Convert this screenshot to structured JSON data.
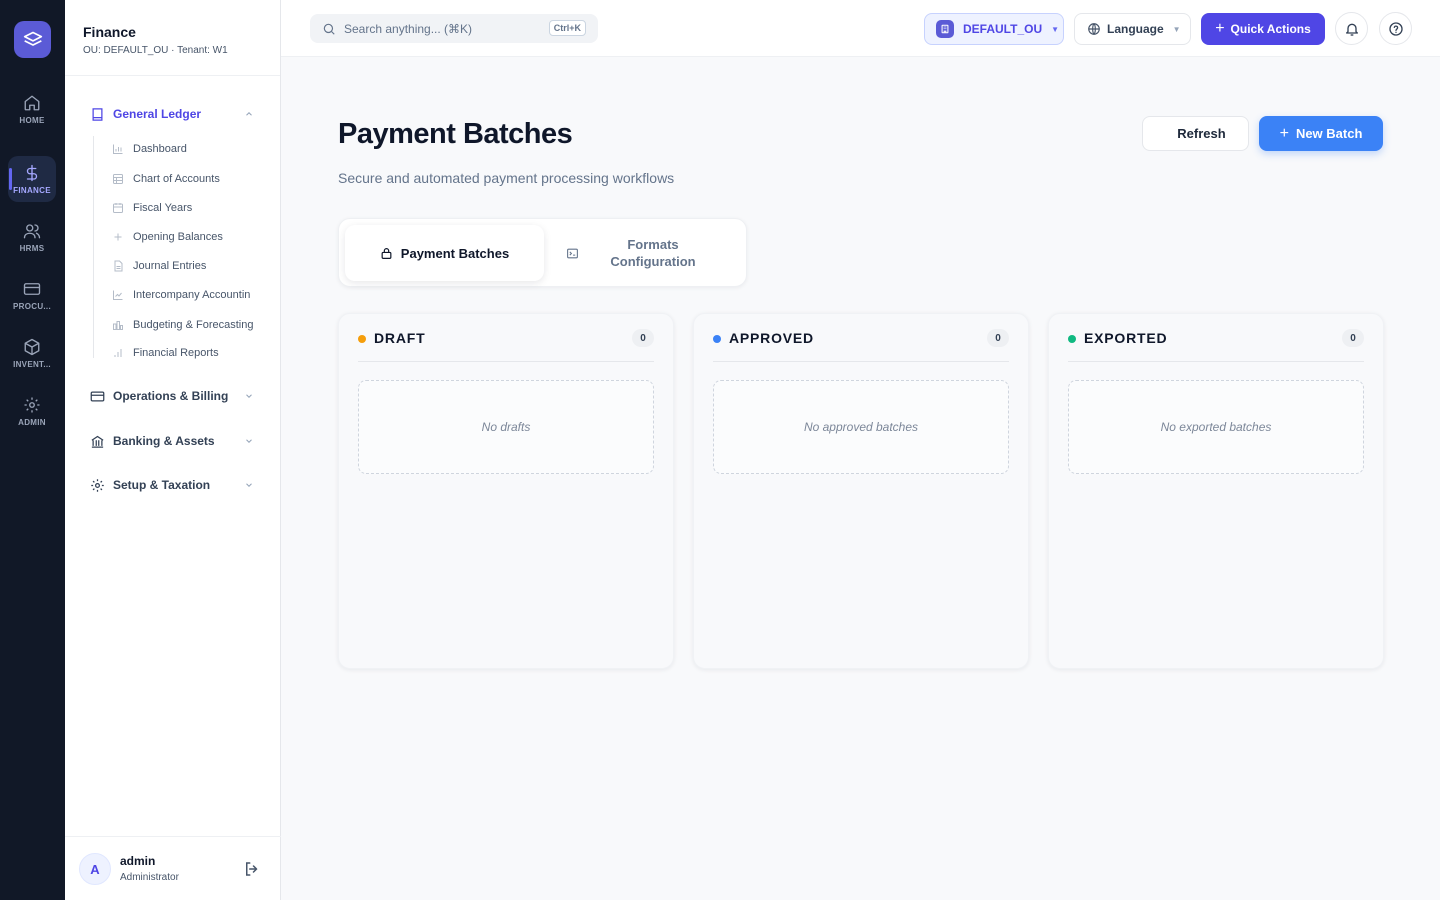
{
  "rail": {
    "items": [
      {
        "label": "HOME",
        "icon": "home-icon"
      },
      {
        "label": "FINANCE",
        "icon": "dollar-icon",
        "active": true
      },
      {
        "label": "HRMS",
        "icon": "users-icon"
      },
      {
        "label": "PROCU...",
        "icon": "card-icon"
      },
      {
        "label": "INVENT...",
        "icon": "box-icon"
      },
      {
        "label": "ADMIN",
        "icon": "gear-icon"
      }
    ]
  },
  "sidebar": {
    "title": "Finance",
    "subtitle": "OU: DEFAULT_OU · Tenant: W1",
    "groups": [
      {
        "label": "General Ledger",
        "icon": "book-icon",
        "open": true
      },
      {
        "label": "Operations & Billing",
        "icon": "billing-icon"
      },
      {
        "label": "Banking & Assets",
        "icon": "bank-icon"
      },
      {
        "label": "Setup & Taxation",
        "icon": "settings-icon"
      }
    ],
    "gl_items": [
      {
        "label": "Dashboard",
        "icon": "bar-chart-icon"
      },
      {
        "label": "Chart of Accounts",
        "icon": "table-icon"
      },
      {
        "label": "Fiscal Years",
        "icon": "calendar-icon"
      },
      {
        "label": "Opening Balances",
        "icon": "plus-icon"
      },
      {
        "label": "Journal Entries",
        "icon": "document-icon"
      },
      {
        "label": "Intercompany Accountin",
        "icon": "line-chart-icon"
      },
      {
        "label": "Budgeting & Forecasting",
        "icon": "budget-icon"
      },
      {
        "label": "Financial Reports",
        "icon": "report-icon"
      }
    ],
    "user": {
      "initial": "A",
      "name": "admin",
      "role": "Administrator"
    }
  },
  "topbar": {
    "search_placeholder": "Search anything... (⌘K)",
    "search_shortcut": "Ctrl+K",
    "ou_label": "DEFAULT_OU",
    "language_label": "Language",
    "quick_actions_label": "Quick Actions"
  },
  "main": {
    "title": "Payment Batches",
    "subtitle": "Secure and automated payment processing workflows",
    "refresh_label": "Refresh",
    "new_batch_label": "New Batch",
    "tabs": [
      {
        "label": "Payment Batches",
        "active": true
      },
      {
        "label": "Formats Configuration",
        "active": false
      }
    ],
    "columns": [
      {
        "title": "DRAFT",
        "count": "0",
        "empty_text": "No drafts",
        "color": "#f59e0b"
      },
      {
        "title": "APPROVED",
        "count": "0",
        "empty_text": "No approved batches",
        "color": "#3b82f6"
      },
      {
        "title": "EXPORTED",
        "count": "0",
        "empty_text": "No exported batches",
        "color": "#10b981"
      }
    ]
  },
  "colors": {
    "accent": "#4f46e5",
    "primary_button": "#3b82f6",
    "rail_bg": "#111827"
  }
}
